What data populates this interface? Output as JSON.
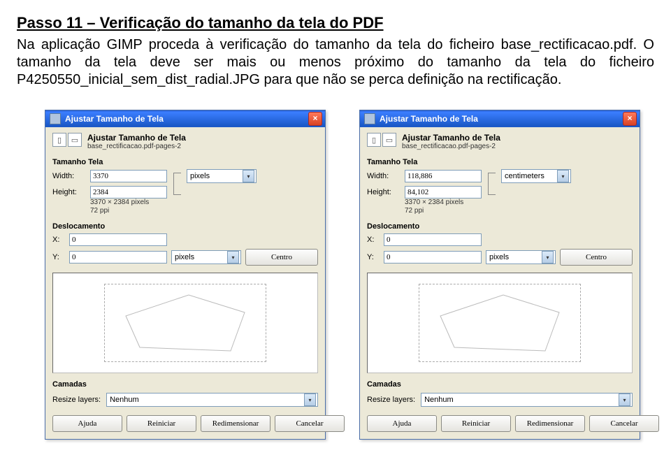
{
  "doc": {
    "title": "Passo 11 – Verificação do tamanho da tela do PDF",
    "paragraph": "Na aplicação GIMP proceda à verificação do tamanho da tela do ficheiro base_rectificacao.pdf. O tamanho da tela deve ser mais ou menos próximo do tamanho da tela do ficheiro P4250550_inicial_sem_dist_radial.JPG para que não se perca definição na rectificação."
  },
  "dialog_left": {
    "window_title": "Ajustar Tamanho de Tela",
    "sub_title": "Ajustar Tamanho de Tela",
    "sub_file": "base_rectificacao.pdf-pages-2",
    "section_size": "Tamanho Tela",
    "width_label": "Width:",
    "height_label": "Height:",
    "width_value": "3370",
    "height_value": "2384",
    "unit_value": "pixels",
    "dims_note1": "3370 × 2384 pixels",
    "dims_note2": "72 ppi",
    "section_offset": "Deslocamento",
    "x_label": "X:",
    "y_label": "Y:",
    "x_value": "0",
    "y_value": "0",
    "offset_unit": "pixels",
    "center_btn": "Centro",
    "section_layers": "Camadas",
    "resize_layers_label": "Resize layers:",
    "resize_layers_value": "Nenhum",
    "btn_help": "Ajuda",
    "btn_reset": "Reiniciar",
    "btn_resize": "Redimensionar",
    "btn_cancel": "Cancelar"
  },
  "dialog_right": {
    "window_title": "Ajustar Tamanho de Tela",
    "sub_title": "Ajustar Tamanho de Tela",
    "sub_file": "base_rectificacao.pdf-pages-2",
    "section_size": "Tamanho Tela",
    "width_label": "Width:",
    "height_label": "Height:",
    "width_value": "118,886",
    "height_value": "84,102",
    "unit_value": "centimeters",
    "dims_note1": "3370 × 2384 pixels",
    "dims_note2": "72 ppi",
    "section_offset": "Deslocamento",
    "x_label": "X:",
    "y_label": "Y:",
    "x_value": "0",
    "y_value": "0",
    "offset_unit": "pixels",
    "center_btn": "Centro",
    "section_layers": "Camadas",
    "resize_layers_label": "Resize layers:",
    "resize_layers_value": "Nenhum",
    "btn_help": "Ajuda",
    "btn_reset": "Reiniciar",
    "btn_resize": "Redimensionar",
    "btn_cancel": "Cancelar"
  }
}
